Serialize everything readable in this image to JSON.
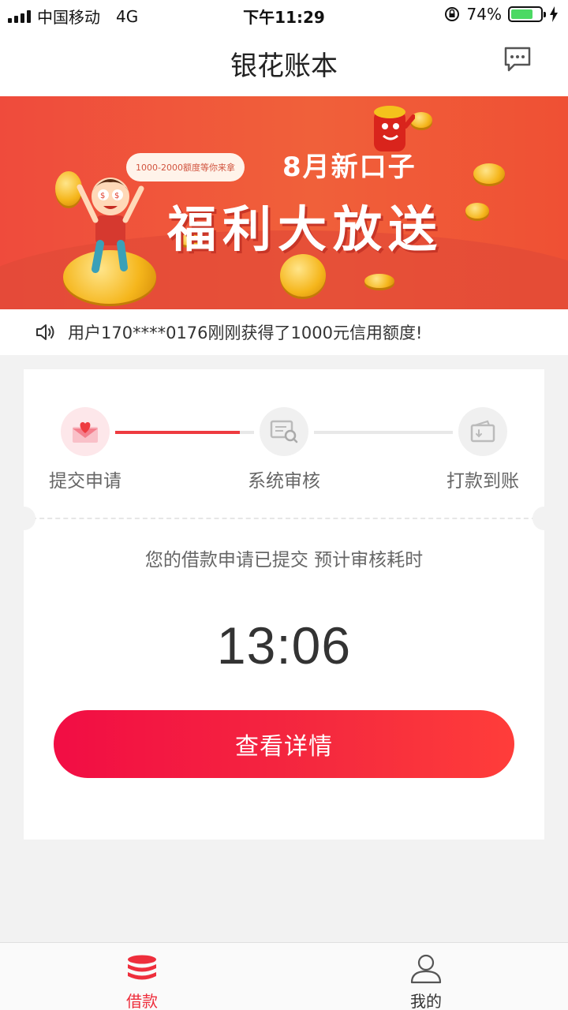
{
  "status_bar": {
    "carrier": "中国移动",
    "network": "4G",
    "time": "下午11:29",
    "battery_percent": "74%",
    "battery_level": 0.74
  },
  "header": {
    "title": "银花账本",
    "message_icon": "chat-bubble-icon"
  },
  "banner": {
    "bubble_text": "1000-2000额度等你来拿",
    "subtitle": "8月新口子",
    "headline": "福利大放送"
  },
  "notice": {
    "icon": "speaker-icon",
    "text": "用户170****0176刚刚获得了1000元信用额度!"
  },
  "progress": {
    "steps": [
      {
        "label": "提交申请",
        "icon": "envelope-heart-icon"
      },
      {
        "label": "系统审核",
        "icon": "review-search-icon"
      },
      {
        "label": "打款到账",
        "icon": "wallet-icon"
      }
    ],
    "line1_progress": 0.9,
    "line2_progress": 0
  },
  "main": {
    "message": "您的借款申请已提交 预计审核耗时",
    "countdown": "13:06",
    "button_label": "查看详情"
  },
  "tabbar": {
    "tabs": [
      {
        "label": "借款",
        "icon": "coins-stack-icon",
        "active": true
      },
      {
        "label": "我的",
        "icon": "user-icon",
        "active": false
      }
    ]
  },
  "colors": {
    "accent": "#ee2e3c",
    "banner": "#ef4b3c"
  }
}
